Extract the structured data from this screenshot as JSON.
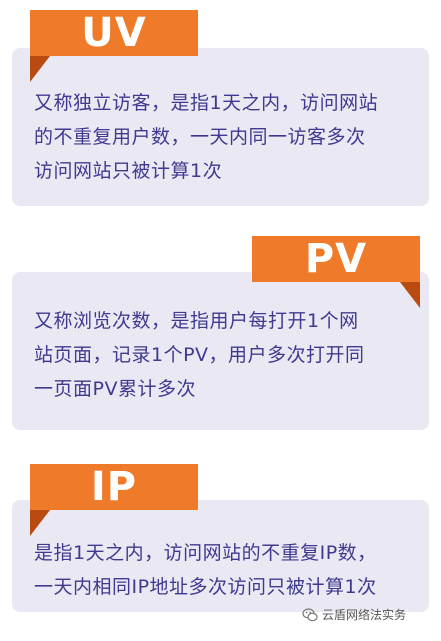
{
  "sections": [
    {
      "tab_label": "UV",
      "text": "又称独立访客，是指1天之内，访问网站\n的不重复用户数，一天内同一访客多次\n访问网站只被计算1次"
    },
    {
      "tab_label": "PV",
      "text": "又称浏览次数，是指用户每打开1个网\n站页面，记录1个PV，用户多次打开同\n一页面PV累计多次"
    },
    {
      "tab_label": "IP",
      "text": "是指1天之内，访问网站的不重复IP数，\n一天内相同IP地址多次访问只被计算1次"
    }
  ],
  "watermark": {
    "text": "云盾网络法实务",
    "icon": "wechat-icon"
  },
  "colors": {
    "accent": "#ee7a2a",
    "accent_dark": "#b84a12",
    "card_bg": "#e9e8f3",
    "text": "#3f3a8f"
  }
}
